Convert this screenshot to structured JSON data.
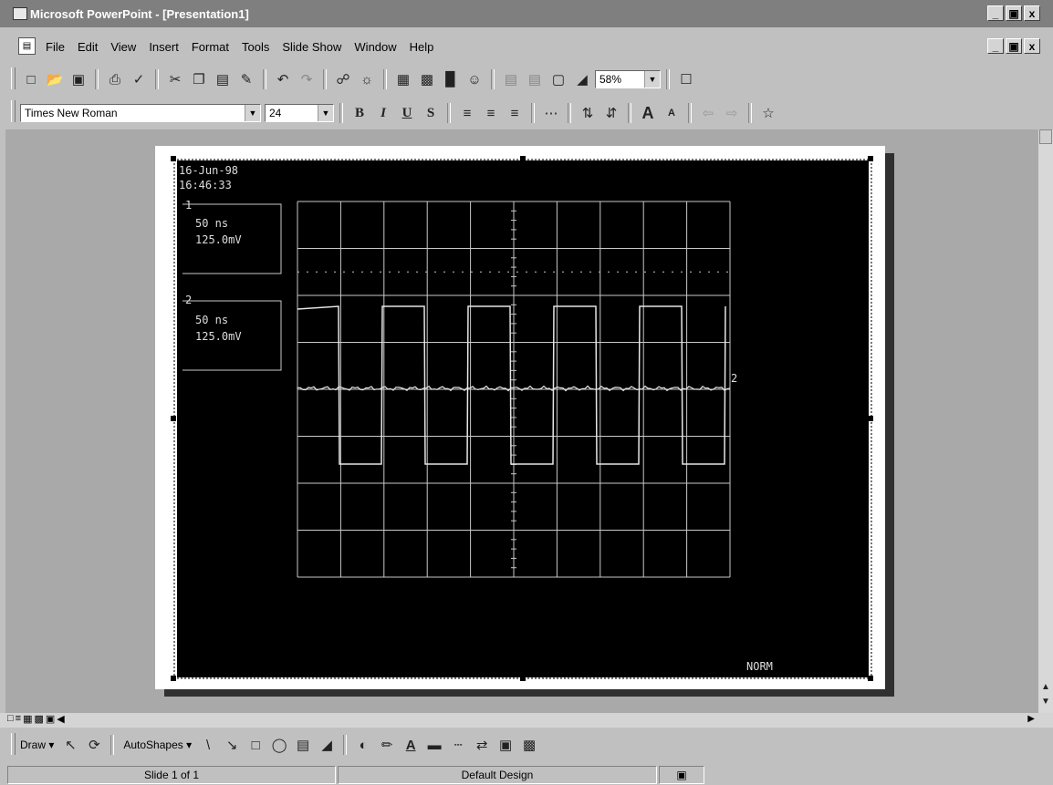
{
  "window": {
    "title": "Microsoft PowerPoint - [Presentation1]",
    "controls": [
      "_",
      "▣",
      "x"
    ]
  },
  "menu": {
    "items": [
      "File",
      "Edit",
      "View",
      "Insert",
      "Format",
      "Tools",
      "Slide Show",
      "Window",
      "Help"
    ]
  },
  "toolbar": {
    "zoom": "58%"
  },
  "format": {
    "font": "Times New Roman",
    "size": "24"
  },
  "slide": {
    "date": "16-Jun-98",
    "time": "16:46:33",
    "ch1_label": "1",
    "ch1_line1": "50 ns",
    "ch1_line2": "125.0mV",
    "ch2_label": "2",
    "ch2_line1": "50 ns",
    "ch2_line2": "125.0mV",
    "ch2_marker": "2",
    "mode": "NORM"
  },
  "draw": {
    "draw_label": "Draw ▾",
    "autoshapes_label": "AutoShapes ▾"
  },
  "status": {
    "slide_info": "Slide 1 of 1",
    "design": "Default Design"
  },
  "colors": {
    "title_bar": "#7f7f7f",
    "chrome": "#c0c0c0",
    "workspace": "#a9a9a9",
    "trace": "#e6e6e6",
    "graticule": "#c8c8c8"
  }
}
